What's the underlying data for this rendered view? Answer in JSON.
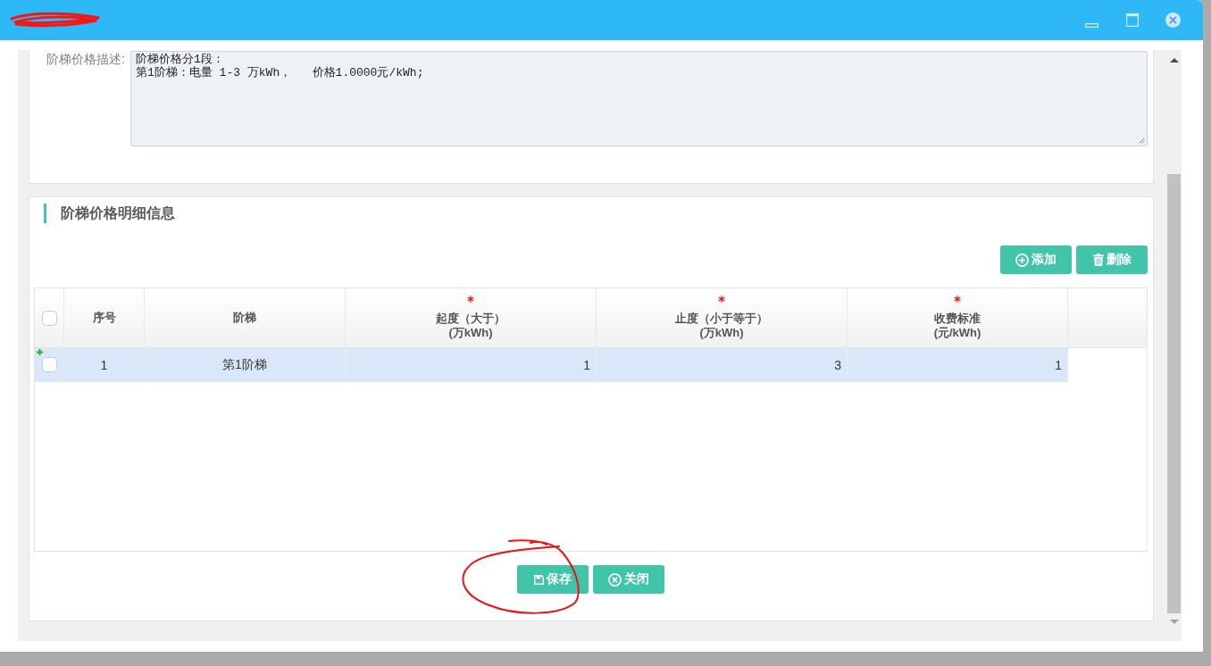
{
  "form": {
    "description": {
      "label": "阶梯价格描述:",
      "lines": [
        "阶梯价格分1段：",
        "第1阶梯：电量 1-3 万kWh，   价格1.0000元/kWh;"
      ]
    }
  },
  "detail_section": {
    "title": "阶梯价格明细信息",
    "toolbar": [
      {
        "label": "添加",
        "kind": "add"
      },
      {
        "label": "删除",
        "kind": "delete"
      }
    ],
    "table": {
      "select_all": {
        "checked": false
      },
      "columns": [
        {
          "kind": "index",
          "label": "序号",
          "required": false
        },
        {
          "kind": "text",
          "label": "阶梯",
          "required": false
        },
        {
          "kind": "number",
          "label": "起度（大于）\n(万kWh)",
          "required": true
        },
        {
          "kind": "number",
          "label": "止度（小于等于）\n(万kWh)",
          "required": true
        },
        {
          "kind": "number",
          "label": "收费标准\n(元/kWh)",
          "required": true
        }
      ],
      "rows": [
        {
          "selected": true,
          "added": true,
          "checked": false,
          "cells": [
            "1",
            "第1阶梯",
            "1",
            "3",
            "1"
          ]
        }
      ]
    }
  },
  "footer_buttons": [
    {
      "label": "保存",
      "kind": "save"
    },
    {
      "label": "关闭",
      "kind": "close"
    }
  ]
}
